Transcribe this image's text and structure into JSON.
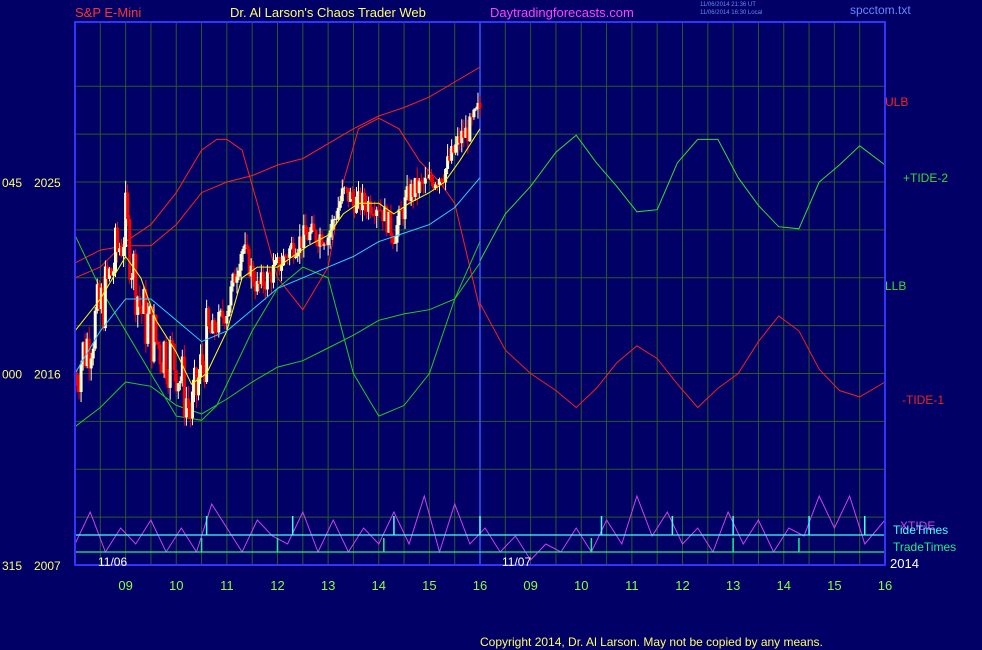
{
  "header": {
    "symbol": "S&P E-Mini",
    "site": "Dr. Al Larson's Chaos Trader Web",
    "url": "Daytradingforecasts.com",
    "stamp1": "11/06/2014 21:36 UT",
    "stamp2": "11/06/2014 16:30 Local",
    "file": "spcctom.txt"
  },
  "copyright": "Copyright 2014, Dr. Al Larson. May not be copied by any means.",
  "colors": {
    "background": "#000066",
    "frame": "#3333ff",
    "grid": "#2a5a2a",
    "price_up": "#ffffcc",
    "price_down": "#ff0000",
    "upper_band": "#ff2020",
    "lower_band": "#22cc22",
    "ma_fast": "#ffff00",
    "ma_slow": "#33ccff",
    "tide_plus": "#33dd33",
    "tide_minus": "#ee2222",
    "xtide": "#cc44ee",
    "tide_times": "#44ffff",
    "trade_times": "#22ee88",
    "time_labels": "#88ff44"
  },
  "chart_data": {
    "type": "line",
    "xlabel": "",
    "ylabel": "",
    "x_ticks": [
      "09",
      "10",
      "11",
      "12",
      "13",
      "14",
      "15",
      "16",
      "09",
      "10",
      "11",
      "12",
      "13",
      "14",
      "15",
      "16"
    ],
    "date_labels": [
      "11/06",
      "11/07"
    ],
    "year_label": "2014",
    "y_ticks": [
      {
        "left": "045",
        "right": "2025",
        "value": 2025
      },
      {
        "left": "000",
        "right": "2016",
        "value": 2016
      },
      {
        "left": "315",
        "right": "2007",
        "value": 2007
      }
    ],
    "ylim": [
      2007,
      2030
    ],
    "series_labels": [
      {
        "name": "ULB",
        "color": "#ff2020"
      },
      {
        "name": "+TIDE-2",
        "color": "#33dd33"
      },
      {
        "name": "LLB",
        "color": "#33dd33"
      },
      {
        "name": "-TIDE-1",
        "color": "#ee2222"
      },
      {
        "name": "XTIDE",
        "color": "#cc44ee"
      },
      {
        "name": "TideTimes",
        "color": "#44ffff"
      },
      {
        "name": "TradeTimes",
        "color": "#22ee88"
      }
    ],
    "price_bars": {
      "time": [
        8.0,
        8.5,
        9.0,
        9.3,
        9.6,
        10.0,
        10.3,
        10.6,
        11.0,
        11.3,
        11.6,
        12.0,
        12.3,
        12.6,
        13.0,
        13.3,
        13.6,
        14.0,
        14.3,
        14.6,
        15.0,
        15.3,
        15.6,
        15.8,
        16.0
      ],
      "close": [
        2016.0,
        2019.0,
        2023.0,
        2019.0,
        2017.5,
        2016.5,
        2014.0,
        2017.5,
        2019.0,
        2022.0,
        2020.0,
        2021.0,
        2022.0,
        2022.5,
        2022.5,
        2024.5,
        2024.0,
        2024.0,
        2022.5,
        2024.5,
        2025.0,
        2025.5,
        2027.0,
        2027.5,
        2028.5
      ]
    },
    "upper_band": {
      "time": [
        8.0,
        8.5,
        9.0,
        9.5,
        10.0,
        10.5,
        11.0,
        11.5,
        12.0,
        12.5,
        13.0,
        13.5,
        14.0,
        14.5,
        15.0,
        15.5,
        16.0
      ],
      "values": [
        2021.2,
        2021.8,
        2022.0,
        2022.0,
        2023.0,
        2024.5,
        2025.0,
        2025.3,
        2025.8,
        2026.1,
        2026.8,
        2027.5,
        2028.1,
        2028.5,
        2029.0,
        2029.7,
        2030.4
      ]
    },
    "lower_band": {
      "time": [
        8.0,
        8.5,
        9.0,
        9.5,
        10.0,
        10.5,
        11.0,
        11.5,
        12.0,
        12.5,
        13.0,
        13.5,
        14.0,
        14.5,
        15.0,
        15.5,
        16.0
      ],
      "values": [
        2013.5,
        2014.4,
        2015.6,
        2015.4,
        2014.5,
        2014.1,
        2014.8,
        2015.6,
        2016.3,
        2016.6,
        2017.2,
        2017.8,
        2018.5,
        2018.8,
        2019.0,
        2019.5,
        2021.2
      ]
    },
    "ma_fast": {
      "time": [
        8.0,
        8.5,
        9.0,
        9.3,
        9.6,
        10.0,
        10.3,
        10.6,
        11.0,
        11.3,
        11.6,
        12.0,
        12.3,
        12.6,
        13.0,
        13.3,
        13.6,
        14.0,
        14.3,
        14.6,
        15.0,
        15.3,
        15.6,
        16.0
      ],
      "values": [
        2018.0,
        2019.5,
        2021.5,
        2020.5,
        2018.5,
        2017.0,
        2015.5,
        2016.0,
        2018.0,
        2020.5,
        2021.0,
        2021.0,
        2021.5,
        2022.0,
        2022.5,
        2023.5,
        2024.0,
        2024.0,
        2023.5,
        2024.0,
        2024.5,
        2025.0,
        2026.0,
        2027.5
      ]
    },
    "ma_slow": {
      "time": [
        8.0,
        8.5,
        9.0,
        9.5,
        10.0,
        10.5,
        11.0,
        11.5,
        12.0,
        12.5,
        13.0,
        13.5,
        14.0,
        14.5,
        15.0,
        15.5,
        16.0
      ],
      "values": [
        2016.0,
        2018.0,
        2019.5,
        2019.5,
        2018.5,
        2017.5,
        2018.0,
        2019.0,
        2020.0,
        2020.5,
        2021.0,
        2021.5,
        2022.2,
        2022.6,
        2023.0,
        2023.8,
        2025.2
      ]
    },
    "cycle_red": {
      "time": [
        8.0,
        8.5,
        9.0,
        9.5,
        10.0,
        10.5,
        10.8,
        11.0,
        11.3,
        11.6,
        12.0,
        12.5,
        13.0,
        13.3,
        13.6,
        14.0,
        14.4,
        14.8,
        15.2,
        15.5,
        16.0
      ],
      "values": [
        2020.5,
        2021.0,
        2022.2,
        2023.0,
        2024.5,
        2026.5,
        2027.0,
        2027.0,
        2026.5,
        2024.0,
        2020.5,
        2019.0,
        2021.0,
        2025.0,
        2027.5,
        2028.0,
        2027.5,
        2026.0,
        2025.0,
        2024.0,
        2019.0
      ]
    },
    "cycle_green": {
      "time": [
        8.0,
        8.5,
        9.0,
        9.5,
        10.0,
        10.5,
        10.8,
        11.0,
        11.5,
        12.0,
        12.5,
        13.0,
        13.5,
        14.0,
        14.5,
        15.0,
        15.5,
        16.0
      ],
      "values": [
        2022.5,
        2020.0,
        2018.0,
        2016.0,
        2014.0,
        2013.8,
        2014.5,
        2015.5,
        2018.0,
        2020.0,
        2021.0,
        2020.5,
        2016.0,
        2014.0,
        2014.5,
        2016.0,
        2019.5,
        2022.2
      ]
    },
    "tide_plus": {
      "time": [
        16.0,
        16.5,
        17.0,
        17.5,
        17.9,
        18.3,
        18.7,
        19.1,
        19.5,
        19.9,
        20.3,
        20.7,
        21.1,
        21.5,
        21.9,
        22.3,
        22.7,
        23.1,
        23.5,
        24.0
      ],
      "values": [
        2021.3,
        2023.5,
        2024.8,
        2026.4,
        2027.2,
        2025.9,
        2024.8,
        2023.6,
        2023.7,
        2025.9,
        2027.0,
        2027.0,
        2025.2,
        2023.9,
        2022.9,
        2022.8,
        2025.0,
        2025.8,
        2026.7,
        2025.8
      ]
    },
    "tide_minus": {
      "time": [
        16.0,
        16.5,
        17.0,
        17.5,
        17.9,
        18.3,
        18.7,
        19.1,
        19.5,
        19.9,
        20.3,
        20.7,
        21.1,
        21.5,
        21.9,
        22.3,
        22.7,
        23.1,
        23.5,
        24.0
      ],
      "values": [
        2019.3,
        2017.1,
        2016.0,
        2015.2,
        2014.4,
        2015.3,
        2016.5,
        2017.3,
        2016.7,
        2015.5,
        2014.4,
        2015.3,
        2016.0,
        2017.5,
        2018.7,
        2018.0,
        2016.2,
        2015.2,
        2014.9,
        2015.6
      ]
    },
    "xtide": {
      "time": [
        8.0,
        8.3,
        8.6,
        8.9,
        9.2,
        9.5,
        9.8,
        10.1,
        10.4,
        10.7,
        11.0,
        11.3,
        11.6,
        11.9,
        12.2,
        12.5,
        12.8,
        13.1,
        13.4,
        13.7,
        14.0,
        14.3,
        14.6,
        14.9,
        15.2,
        15.5,
        15.8,
        16.1,
        16.4,
        16.7,
        17.0,
        17.3,
        17.6,
        17.9,
        18.2,
        18.5,
        18.8,
        19.1,
        19.4,
        19.7,
        20.0,
        20.3,
        20.6,
        20.9,
        21.2,
        21.5,
        21.8,
        22.1,
        22.4,
        22.7,
        23.0,
        23.3,
        23.6,
        24.0
      ],
      "values": [
        0.3,
        0.7,
        0.2,
        0.5,
        0.3,
        0.6,
        0.2,
        0.5,
        0.2,
        0.8,
        0.5,
        0.2,
        0.6,
        0.4,
        0.3,
        0.7,
        0.2,
        0.6,
        0.2,
        0.5,
        0.3,
        0.7,
        0.3,
        0.9,
        0.2,
        0.8,
        0.3,
        0.5,
        0.2,
        0.4,
        0.1,
        0.3,
        0.2,
        0.5,
        0.2,
        0.6,
        0.3,
        0.9,
        0.4,
        0.7,
        0.3,
        0.5,
        0.2,
        0.7,
        0.3,
        0.6,
        0.2,
        0.5,
        0.4,
        0.9,
        0.5,
        0.9,
        0.3,
        0.6
      ]
    },
    "tide_time_marks": [
      10.6,
      12.3,
      14.3,
      16.0,
      18.4,
      19.8,
      21.0,
      22.5,
      23.6
    ],
    "trade_time_marks": [
      10.5,
      12.0,
      14.1,
      18.2,
      21.0,
      22.3
    ]
  }
}
